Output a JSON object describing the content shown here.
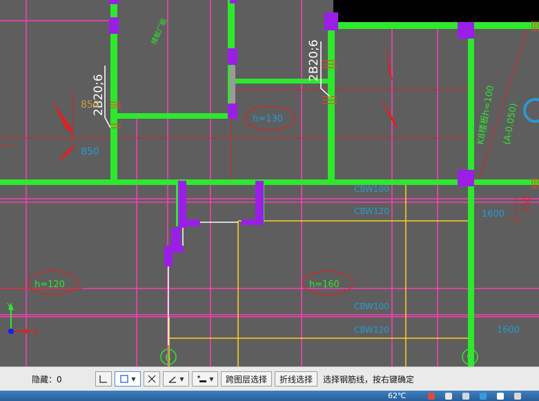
{
  "canvas": {
    "labels": {
      "rebar_left": "2B20;6",
      "rebar_right": "2B20;6",
      "dim_850a": "850",
      "dim_850b": "850",
      "h_130": "h=130",
      "h_120": "h=120",
      "h_160": "h=160",
      "beam_k8": "K8楼板h=100",
      "elev": "(A-0.050)",
      "dim_750": "750",
      "dim_1600a": "1600",
      "dim_1600b": "1600",
      "cbw_a": "CBW100",
      "cbw_b": "CBW120",
      "cbw_c": "CBW100",
      "cbw_d": "CBW120",
      "grid_6": "6",
      "grid_9": "9",
      "axis_x": "X",
      "axis_y": "Y",
      "green_note": "楼板厂筋"
    }
  },
  "statusbar": {
    "hidden_label": "隐藏：0",
    "btn_cross_layer": "跨图层选择",
    "btn_polyline": "折线选择",
    "message": "选择钢筋线，按右键确定"
  },
  "taskbar": {
    "temperature": "62℃"
  }
}
